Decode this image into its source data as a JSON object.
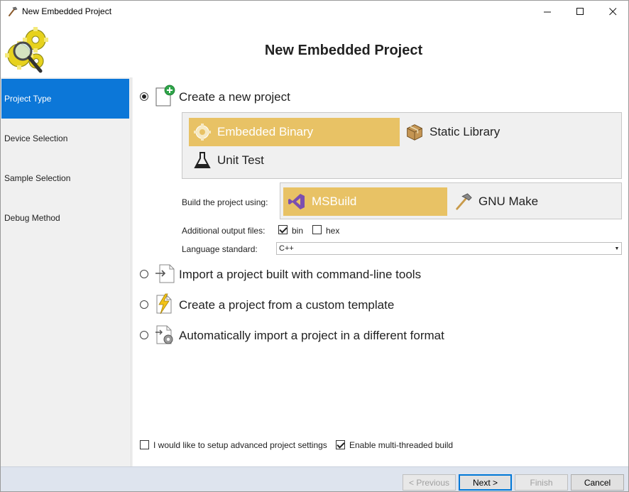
{
  "window": {
    "title": "New Embedded Project",
    "controls": {
      "minimize": "—",
      "maximize": "☐",
      "close": "✕"
    }
  },
  "header": {
    "title": "New Embedded Project",
    "logo_icon": "gears-magnifier-icon"
  },
  "sidebar": {
    "items": [
      {
        "label": "Project Type",
        "active": true
      },
      {
        "label": "Device Selection",
        "active": false
      },
      {
        "label": "Sample Selection",
        "active": false
      },
      {
        "label": "Debug Method",
        "active": false
      }
    ],
    "active_color": "#0c77d8"
  },
  "main": {
    "options": [
      {
        "label": "Create a new project",
        "selected": true,
        "icon": "new-project-icon"
      },
      {
        "label": "Import a project built with command-line tools",
        "selected": false,
        "icon": "import-icon"
      },
      {
        "label": "Create a project from a custom template",
        "selected": false,
        "icon": "template-icon"
      },
      {
        "label": "Automatically import a project in a different format",
        "selected": false,
        "icon": "auto-import-icon"
      }
    ],
    "project_types": [
      {
        "label": "Embedded Binary",
        "selected": true,
        "icon": "gear-icon"
      },
      {
        "label": "Static Library",
        "selected": false,
        "icon": "box-icon"
      },
      {
        "label": "Unit Test",
        "selected": false,
        "icon": "flask-icon"
      }
    ],
    "build": {
      "label": "Build the project using:",
      "tools": [
        {
          "label": "MSBuild",
          "selected": true,
          "icon": "visual-studio-icon"
        },
        {
          "label": "GNU Make",
          "selected": false,
          "icon": "hammer-icon"
        }
      ]
    },
    "output_files": {
      "label": "Additional output files:",
      "bin": {
        "label": "bin",
        "checked": true
      },
      "hex": {
        "label": "hex",
        "checked": false
      }
    },
    "language": {
      "label": "Language standard:",
      "value": "C++"
    },
    "advanced": {
      "label": "I would like to setup advanced project settings",
      "checked": false
    },
    "multithreaded": {
      "label": "Enable multi-threaded build",
      "checked": true
    },
    "selected_color": "#e8c265"
  },
  "footer": {
    "previous": "< Previous",
    "next": "Next >",
    "finish": "Finish",
    "cancel": "Cancel"
  }
}
